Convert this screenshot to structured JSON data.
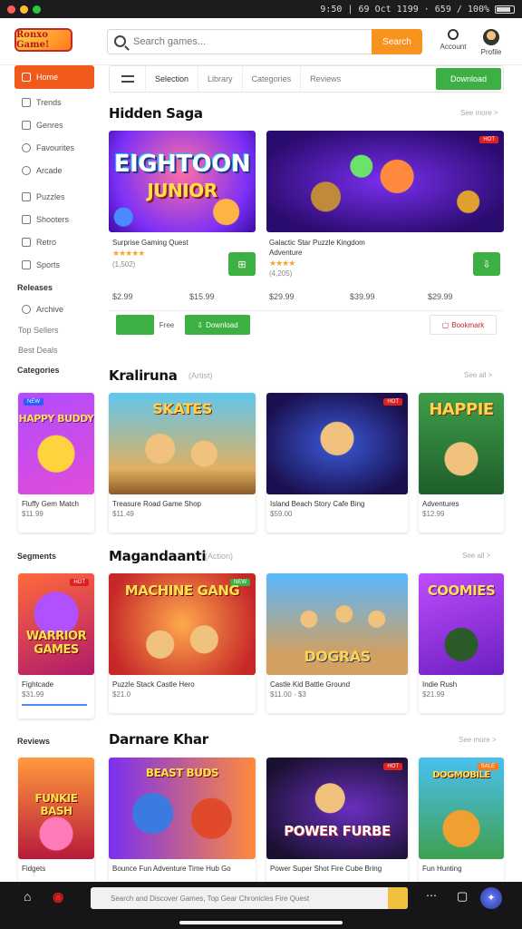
{
  "chrome": {
    "status": "9:50 | 69 Oct 1199 · 659 /  100%"
  },
  "header": {
    "logo": "Ronxo Game!",
    "search_placeholder": "Search games...",
    "search_button": "Search",
    "account_label": "Account",
    "profile_label": "Profile"
  },
  "sidebar": {
    "items": [
      {
        "label": "Home",
        "active": true
      },
      {
        "label": "Trends"
      },
      {
        "label": "Genres"
      },
      {
        "label": "Favourites"
      },
      {
        "label": "Arcade"
      },
      {
        "label": "Puzzles"
      },
      {
        "label": "Shooters"
      },
      {
        "label": "Retro"
      },
      {
        "label": "Sports"
      }
    ],
    "section_heading": "Releases",
    "section_items": [
      "Archive",
      "Top Sellers",
      "Best Deals"
    ],
    "heading2": "Categories",
    "heading3": "Segments",
    "heading4": "Reviews"
  },
  "tabs": {
    "items": [
      "Selection",
      "Library",
      "Categories",
      "Reviews"
    ],
    "cta": "Download"
  },
  "featured": {
    "title": "Hidden Saga",
    "more": "See more >",
    "card1": {
      "art": "EIGHTOON",
      "art2": "JUNIOR",
      "title": "Surprise Gaming Quest",
      "rating": "★★★★★",
      "rating_count": "(1,502)",
      "price_a": "$2.99",
      "price_b": "$15.99"
    },
    "card2": {
      "title": "Galactic Star Puzzle Kingdom",
      "subtitle": "Adventure",
      "rating": "★★★★",
      "rating_count": "(4,205)",
      "price_a": "$29.99",
      "price_b": "$39.99",
      "price_c": "$29.99",
      "badge": "HOT"
    },
    "strip_label": "Free",
    "strip_btn": "Download",
    "strip_right": "Bookmark"
  },
  "row1": {
    "title": "Kraliruna",
    "sub": "(Artist)",
    "more": "See all >",
    "cards": [
      {
        "art": "HAPPY BUDDY",
        "title": "Fluffy Gem Match",
        "price": "$11.99"
      },
      {
        "art": "SKATES",
        "title": "Treasure Road Game Shop",
        "price": "$11.49"
      },
      {
        "art": "",
        "title": "Island Beach Story Cafe Bing",
        "price": "$59.00"
      },
      {
        "art": "HAPPIE",
        "title": "Adventures",
        "price": "$12.99"
      }
    ]
  },
  "row2": {
    "title": "Magandaanti",
    "sub": "(Action)",
    "more": "See all >",
    "cards": [
      {
        "art": "WARRIOR GAMES",
        "title": "Fightcade",
        "price": "$31.99"
      },
      {
        "art": "MACHINE GANG",
        "title": "Puzzle Stack Castle Hero",
        "price": "$21.0"
      },
      {
        "art": "DOGRAS",
        "title": "Castle Kid Battle Ground",
        "price": "$11.00 - $3"
      },
      {
        "art": "COOMIES",
        "title": "Indie Rush",
        "price": "$21.99"
      }
    ]
  },
  "row3": {
    "title": "Darnare Khar",
    "more": "See more >",
    "cards": [
      {
        "art": "FUNKIE BASH",
        "title": "Fidgets"
      },
      {
        "art": "BEAST BUDS",
        "title": "Bounce Fun Adventure Time Hub Go"
      },
      {
        "art": "POWER FURBE",
        "title": "Power Super Shot Fire Cube Bring"
      },
      {
        "art": "DOGMOBILE",
        "title": "Fun Hunting"
      }
    ]
  },
  "bottombar": {
    "search_text": "Search and Discover Games, Top Gear Chronicles Fire Quest"
  }
}
